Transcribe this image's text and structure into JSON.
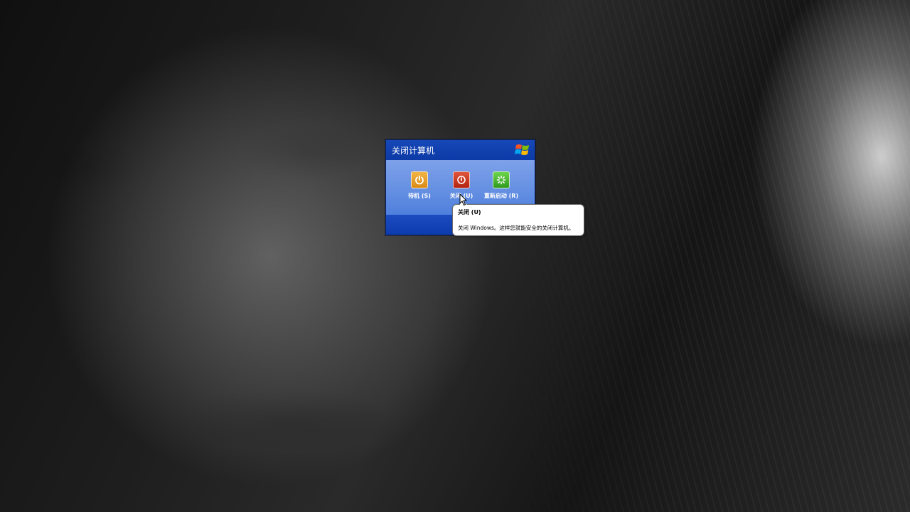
{
  "desktop": {
    "wallpaper": "grayscale portrait wallpaper"
  },
  "dialog": {
    "title": "关闭计算机",
    "logo_icon": "windows-xp-flag-icon",
    "options": [
      {
        "label": "待机 (S)",
        "icon": "power-standby-icon",
        "color": "#e9a22e"
      },
      {
        "label": "关闭 (U)",
        "icon": "power-off-icon",
        "color": "#cc3a22"
      },
      {
        "label": "重新启动 (R)",
        "icon": "restart-icon",
        "color": "#46b832"
      }
    ]
  },
  "tooltip": {
    "title": "关闭 (U)",
    "text": "关闭 Windows。这样您就能安全的关闭计算机。"
  },
  "colors": {
    "dialog_header": "#1748b8",
    "dialog_body": "#6f97e6",
    "tooltip_bg": "#ffffff"
  }
}
